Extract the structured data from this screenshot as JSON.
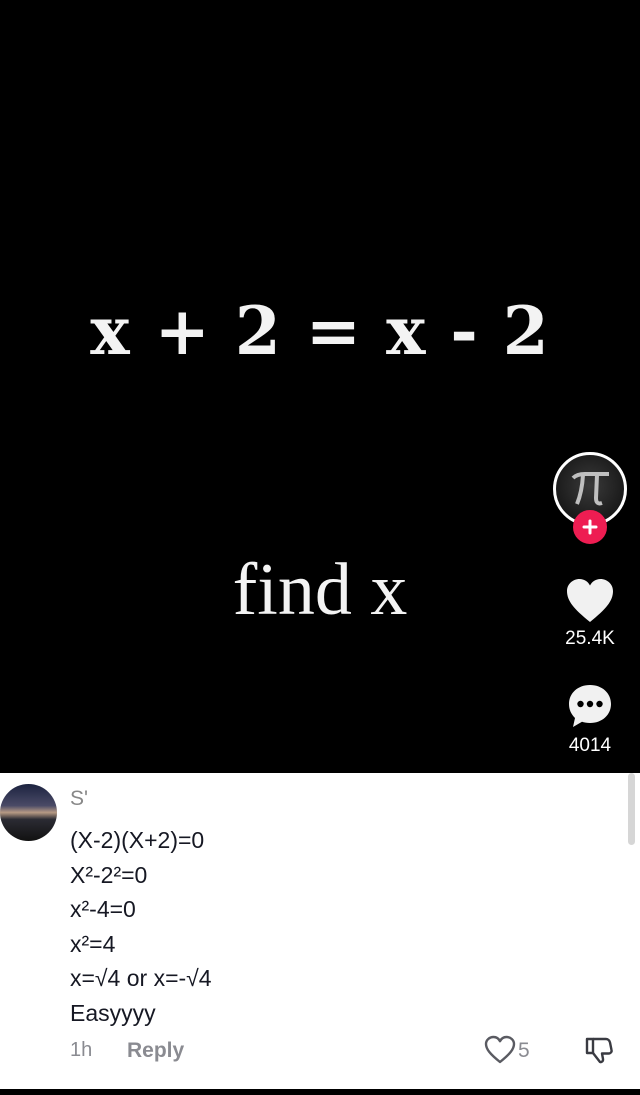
{
  "video": {
    "equation": "x + 2 = x - 2",
    "caption": "find x",
    "profile_avatar_icon": "pi-icon",
    "follow_icon": "plus-icon",
    "like_count": "25.4K",
    "comment_count": "4014"
  },
  "comment": {
    "author": "S'",
    "lines": [
      "(X-2)(X+2)=0",
      "X²-2²=0",
      "x²-4=0",
      "x²=4",
      "x=√4 or x=-√4",
      "Easyyyy"
    ],
    "time": "1h",
    "reply_label": "Reply",
    "like_count": "5"
  },
  "colors": {
    "follow_accent": "#ee1d52",
    "text_primary": "#161823",
    "text_secondary": "#8a8b91"
  }
}
